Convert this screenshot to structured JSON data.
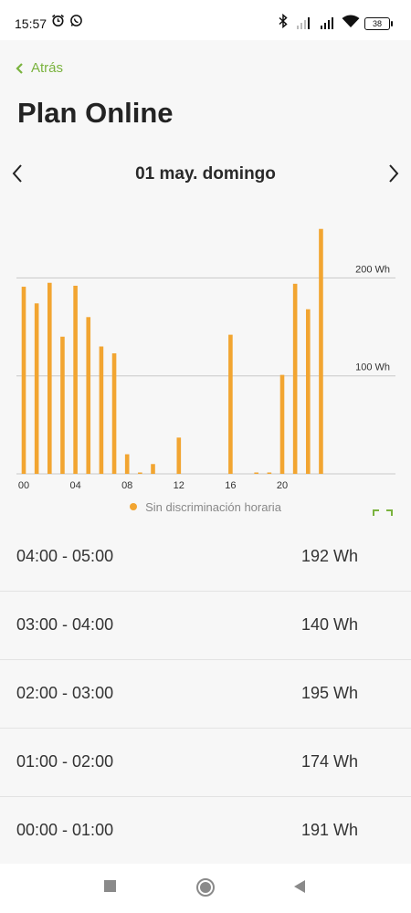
{
  "status_bar": {
    "time": "15:57",
    "battery": "38",
    "icons": [
      "alarm-icon",
      "whatsapp-icon",
      "bluetooth-icon",
      "signal-icon",
      "signal-icon",
      "wifi-icon",
      "battery-icon"
    ]
  },
  "header": {
    "back_label": "Atrás",
    "title": "Plan Online"
  },
  "date_nav": {
    "label": "01 may. domingo",
    "prev_icon": "chevron-left-icon",
    "next_icon": "chevron-right-icon"
  },
  "colors": {
    "accent": "#7ab33e",
    "bar": "#f2a531",
    "background": "#f7f7f7"
  },
  "chart_data": {
    "type": "bar",
    "x_tick_labels": [
      "00",
      "04",
      "08",
      "12",
      "16",
      "20"
    ],
    "y_tick_labels": [
      "100 Wh",
      "200 Wh"
    ],
    "unit": "Wh",
    "categories": [
      "00",
      "01",
      "02",
      "03",
      "04",
      "05",
      "06",
      "07",
      "08",
      "09",
      "10",
      "11",
      "12",
      "13",
      "14",
      "15",
      "16",
      "17",
      "18",
      "19",
      "20",
      "21",
      "22",
      "23"
    ],
    "values": [
      191,
      174,
      195,
      140,
      192,
      160,
      130,
      123,
      20,
      1,
      10,
      0,
      37,
      0,
      0,
      0,
      142,
      0,
      1,
      1,
      101,
      194,
      168,
      250
    ],
    "ylim": [
      0,
      260
    ],
    "series": [
      {
        "name": "Sin discriminación horaria",
        "values": [
          191,
          174,
          195,
          140,
          192,
          160,
          130,
          123,
          20,
          1,
          10,
          0,
          37,
          0,
          0,
          0,
          142,
          0,
          1,
          1,
          101,
          194,
          168,
          250
        ]
      }
    ],
    "gridlines": [
      100,
      200
    ],
    "legend": "bottom"
  },
  "legend": {
    "label": "Sin discriminación horaria",
    "expand_icon": "expand-icon"
  },
  "list": [
    {
      "range": "04:00 - 05:00",
      "value": "192 Wh"
    },
    {
      "range": "03:00 - 04:00",
      "value": "140 Wh"
    },
    {
      "range": "02:00 - 03:00",
      "value": "195 Wh"
    },
    {
      "range": "01:00 - 02:00",
      "value": "174 Wh"
    },
    {
      "range": "00:00 - 01:00",
      "value": "191 Wh"
    }
  ],
  "nav_bar": {
    "icons": [
      "recents-square-icon",
      "home-circle-icon",
      "back-triangle-icon"
    ]
  }
}
